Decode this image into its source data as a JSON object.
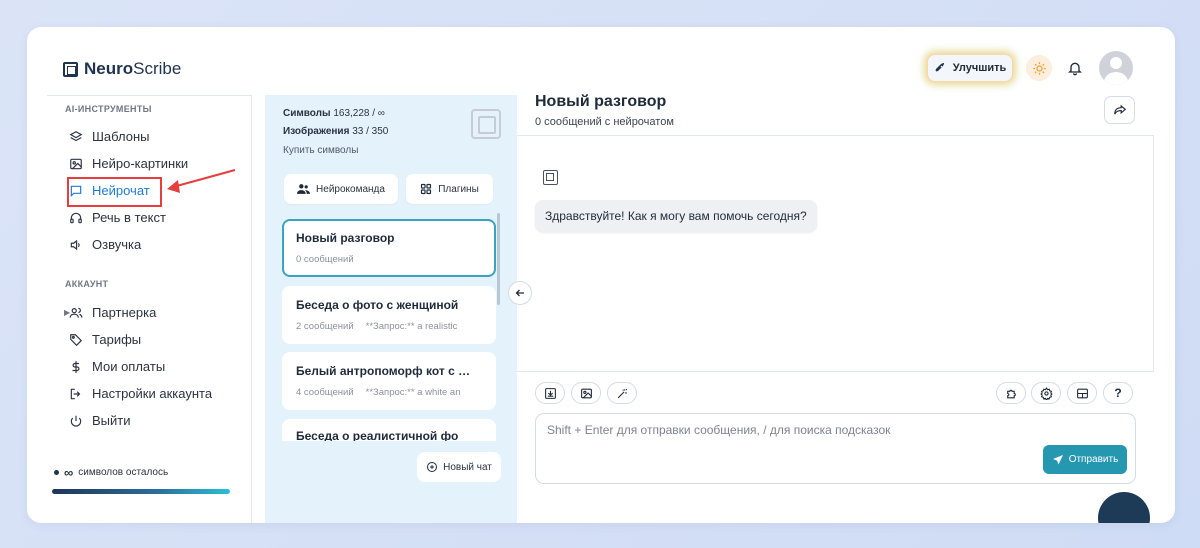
{
  "app": {
    "brand_bold": "Neuro",
    "brand_rest": "Scribe"
  },
  "header": {
    "upgrade_label": "Улучшить"
  },
  "sidebar": {
    "section_tools": "AI-ИНСТРУМЕНТЫ",
    "tools": [
      {
        "label": "Шаблоны",
        "icon": "layers-icon"
      },
      {
        "label": "Нейро-картинки",
        "icon": "image-icon"
      },
      {
        "label": "Нейрочат",
        "icon": "chat-icon"
      },
      {
        "label": "Речь в текст",
        "icon": "headphones-icon"
      },
      {
        "label": "Озвучка",
        "icon": "speaker-icon"
      }
    ],
    "section_account": "АККАУНТ",
    "account": [
      {
        "label": "Партнерка",
        "icon": "users-icon"
      },
      {
        "label": "Тарифы",
        "icon": "tag-icon"
      },
      {
        "label": "Мои оплаты",
        "icon": "dollar-icon"
      },
      {
        "label": "Настройки аккаунта",
        "icon": "logout-icon"
      },
      {
        "label": "Выйти",
        "icon": "power-icon"
      }
    ],
    "credits_symbol": "∞",
    "credits_text": "символов осталось",
    "credits_fraction": 1.0
  },
  "panel": {
    "symbols_label": "Символы",
    "symbols_value": "163,228 / ∞",
    "images_label": "Изображения",
    "images_value": "33 / 350",
    "buy_link": "Купить символы",
    "team_button": "Нейрокоманда",
    "plugins_button": "Плагины",
    "chats": [
      {
        "title": "Новый разговор",
        "count": "0 сообщений",
        "preview": ""
      },
      {
        "title": "Беседа о фото с женщиной",
        "count": "2 сообщений",
        "preview": "**Запрос:** a realistic"
      },
      {
        "title": "Белый антропоморф кот с …",
        "count": "4 сообщений",
        "preview": "**Запрос:** a white an"
      },
      {
        "title": "Беседа о реалистичной фо",
        "count": "",
        "preview": ""
      }
    ],
    "new_chat_button": "Новый чат"
  },
  "main": {
    "title": "Новый разговор",
    "subtitle": "0 сообщений с нейрочатом",
    "greeting": "Здравствуйте! Как я могу вам помочь сегодня?",
    "input_placeholder": "Shift + Enter для отправки сообщения, / для поиска подсказок",
    "send_button": "Отправить",
    "help_label": "?"
  },
  "colors": {
    "accent": "#2697b0",
    "active_nav": "#1f7ad1",
    "panel_bg": "#e4f3fb",
    "annotation": "#e53e3e"
  }
}
